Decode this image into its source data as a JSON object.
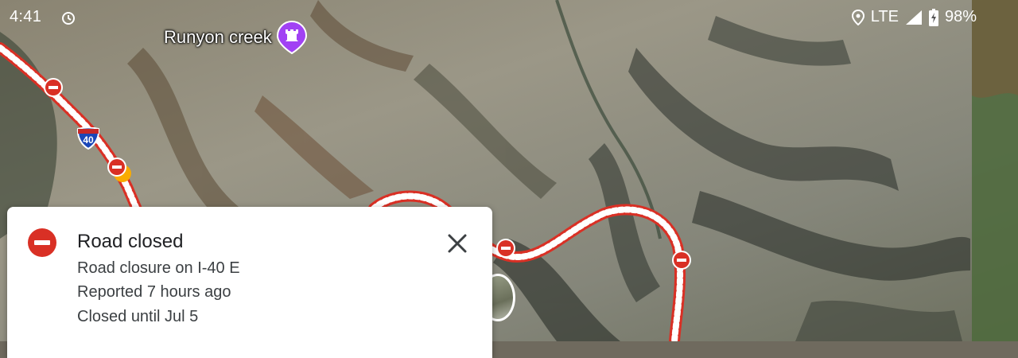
{
  "status_bar": {
    "time": "4:41",
    "alarm_icon": "alarm-clock-icon",
    "location_icon": "location-pin-icon",
    "network": "LTE",
    "signal_icon": "cell-signal-icon",
    "battery_icon": "battery-charging-icon",
    "battery": "98%"
  },
  "map": {
    "style": "satellite",
    "poi": {
      "label": "Runyon creek",
      "icon": "castle-icon",
      "color": "#a142f4"
    },
    "highway_shield": {
      "number": "40",
      "icon": "interstate-shield-icon"
    },
    "closure_marker_icon": "road-closed-icon",
    "closure_color": "#d93025"
  },
  "card": {
    "icon": "road-closed-icon",
    "title": "Road closed",
    "description": "Road closure on I-40 E",
    "reported": "Reported 7 hours ago",
    "until": "Closed until Jul 5",
    "close_icon": "close-icon"
  }
}
